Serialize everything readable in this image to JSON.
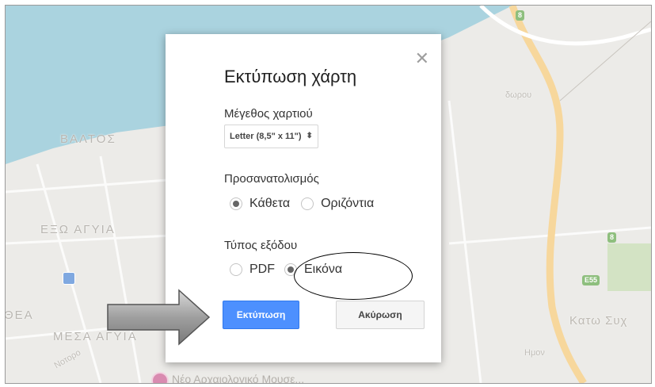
{
  "dialog": {
    "title": "Εκτύπωση χάρτη",
    "close_glyph": "✕",
    "paper_size": {
      "label": "Μέγεθος χαρτιού",
      "selected": "Letter (8,5\" x 11\")",
      "arrows_glyph": "⬍"
    },
    "orientation": {
      "label": "Προσανατολισμός",
      "options": [
        {
          "label": "Κάθετα",
          "checked": true
        },
        {
          "label": "Οριζόντια",
          "checked": false
        }
      ]
    },
    "output_type": {
      "label": "Τύπος εξόδου",
      "options": [
        {
          "label": "PDF",
          "checked": false
        },
        {
          "label": "Εικόνα",
          "checked": true
        }
      ]
    },
    "print_button": "Εκτύπωση",
    "cancel_button": "Ακύρωση"
  },
  "map": {
    "labels": {
      "valtos": "ΒΑΛΤΟΣ",
      "exo_agyia": "ΕΞΩ ΑΓΥΙΑ",
      "thea": "ΘΕΑ",
      "mesa_agyia": "ΜΕΣΑ ΑΓΥΙΑ",
      "katw_syx": "Κατω Συχ",
      "doypoy": "δωρου",
      "street_notoro": "Νοτορο",
      "street_imon": "Ημον",
      "museum": "Νέο Αρχαιολογικό Μουσε..."
    },
    "badges": {
      "top": "8",
      "right": "8",
      "road": "E55"
    },
    "colors": {
      "sea": "#aad3df",
      "land": "#ecebe8",
      "road": "#f7d79c",
      "park": "#c9dfb5"
    }
  },
  "annotations": {
    "highlight_target": "Εικόνα",
    "arrow_target": "Εκτύπωση"
  }
}
